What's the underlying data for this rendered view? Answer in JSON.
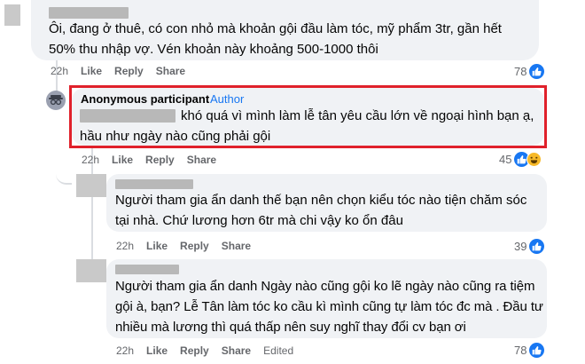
{
  "comments": [
    {
      "text": "Ôi, đang ở thuê, có con nhỏ mà khoản gội đầu làm tóc, mỹ phẩm 3tr, gần hết 50% thu nhập vợ. Vén khoản này khoảng 500-1000 thôi",
      "time": "22h",
      "like": "Like",
      "reply": "Reply",
      "share": "Share",
      "count": "78"
    },
    {
      "author": "Anonymous participant",
      "badge": "Author",
      "text": "khó quá vì mình làm lễ tân yêu cầu lớn về ngoại hình bạn ạ, hầu như ngày nào cũng phải gội",
      "time": "22h",
      "like": "Like",
      "reply": "Reply",
      "share": "Share",
      "count": "45"
    },
    {
      "text": "Người tham gia ẩn danh thế bạn nên chọn kiểu tóc nào tiện chăm sóc tại nhà. Chứ lương hơn 6tr mà chi vậy ko ổn đâu",
      "time": "22h",
      "like": "Like",
      "reply": "Reply",
      "share": "Share",
      "count": "39"
    },
    {
      "text": "Người tham gia ẩn danh Ngày nào cũng gội ko lẽ ngày nào cũng ra tiệm gội à, bạn? Lễ Tân làm tóc ko cầu kì mình cũng tự làm tóc đc mà . Đầu tư nhiều mà lương thì quá thấp nên suy nghĩ thay đổi cv bạn ơi",
      "time": "22h",
      "like": "Like",
      "reply": "Reply",
      "share": "Share",
      "count": "78",
      "edited": "Edited"
    }
  ],
  "colors": {
    "like": "#1877f2",
    "highlight_border": "#e0212b",
    "bubble": "#f0f2f5",
    "author_badge": "#1877f2"
  },
  "icons": [
    "like-icon",
    "haha-icon",
    "anonymous-avatar-icon"
  ]
}
